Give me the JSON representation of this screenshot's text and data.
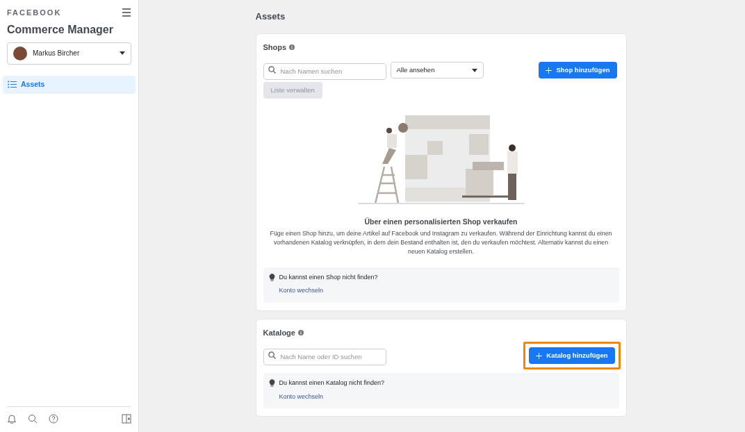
{
  "sidebar": {
    "brand": "FACEBOOK",
    "title": "Commerce Manager",
    "account": {
      "name": "Markus Bircher"
    },
    "items": [
      {
        "label": "Assets",
        "selected": true
      }
    ]
  },
  "page_title": "Assets",
  "shops": {
    "title": "Shops",
    "search": {
      "placeholder": "Nach Namen suchen"
    },
    "filter": {
      "value": "Alle ansehen"
    },
    "add_button": {
      "label": "Shop hinzufügen",
      "highlighted": false
    },
    "manage_button": {
      "label": "Liste verwalten",
      "disabled": true
    },
    "empty": {
      "heading": "Über einen personalisierten Shop verkaufen",
      "text": "Füge einen Shop hinzu, um deine Artikel auf Facebook und Instagram zu verkaufen. Während der Einrichtung kannst du einen vorhandenen Katalog verknüpfen, in dem dein Bestand enthalten ist, den du verkaufen möchtest. Alternativ kannst du einen neuen Katalog erstellen."
    },
    "tip": {
      "text": "Du kannst einen Shop nicht finden?",
      "link": "Konto wechseln"
    }
  },
  "catalogs": {
    "title": "Kataloge",
    "search": {
      "placeholder": "Nach Name oder ID suchen"
    },
    "add_button": {
      "label": "Katalog hinzufügen",
      "highlighted": true
    },
    "tip": {
      "text": "Du kannst einen Katalog nicht finden?",
      "link": "Konto wechseln"
    }
  }
}
